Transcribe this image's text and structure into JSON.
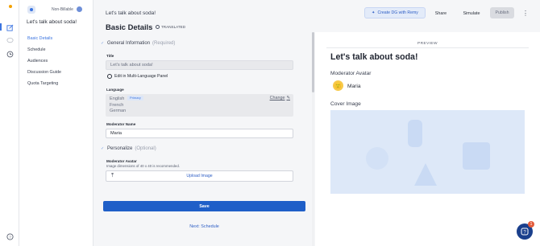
{
  "sidebar": {
    "badge_label": "Non-Billable",
    "study_title": "Let's talk about soda!",
    "nav": [
      "Basic Details",
      "Schedule",
      "Audiences",
      "Discussion Guide",
      "Quota Targeting"
    ]
  },
  "header": {
    "breadcrumb": "Let's talk about soda!",
    "remy_button": "Create DG with Remy",
    "share_button": "Share",
    "simulate_button": "Simulate",
    "publish_button": "Publish",
    "more_icon": "⋮"
  },
  "page": {
    "title": "Basic Details",
    "translated_label": "TRANSLATED"
  },
  "general": {
    "heading": "General Information",
    "qualifier": "(Required)",
    "title_label": "Title",
    "title_value": "Let's talk about soda!",
    "multi_lang_link": "Edit in Multi-Language Panel",
    "language_label": "Language",
    "languages": [
      "English",
      "French",
      "German"
    ],
    "primary_tag": "Primary",
    "change_link": "Change",
    "moderator_label": "Moderator Name",
    "moderator_value": "Maria"
  },
  "personalize": {
    "heading": "Personalize",
    "qualifier": "(Optional)",
    "avatar_label": "Moderator Avatar",
    "avatar_hint": "Image dimensions of 40 x 40 is recommended.",
    "upload_button": "Upload Image"
  },
  "actions": {
    "save": "Save",
    "next": "Next: Schedule"
  },
  "preview": {
    "tag": "PREVIEW",
    "title": "Let's talk about soda!",
    "avatar_heading": "Moderator Avatar",
    "avatar_emoji": "🙂",
    "moderator_name": "Maria",
    "cover_heading": "Cover Image"
  },
  "help": {
    "badge": "1"
  },
  "colors": {
    "accent": "#3b74e0",
    "save": "#1f5fc8",
    "help": "#1a3f8c"
  }
}
